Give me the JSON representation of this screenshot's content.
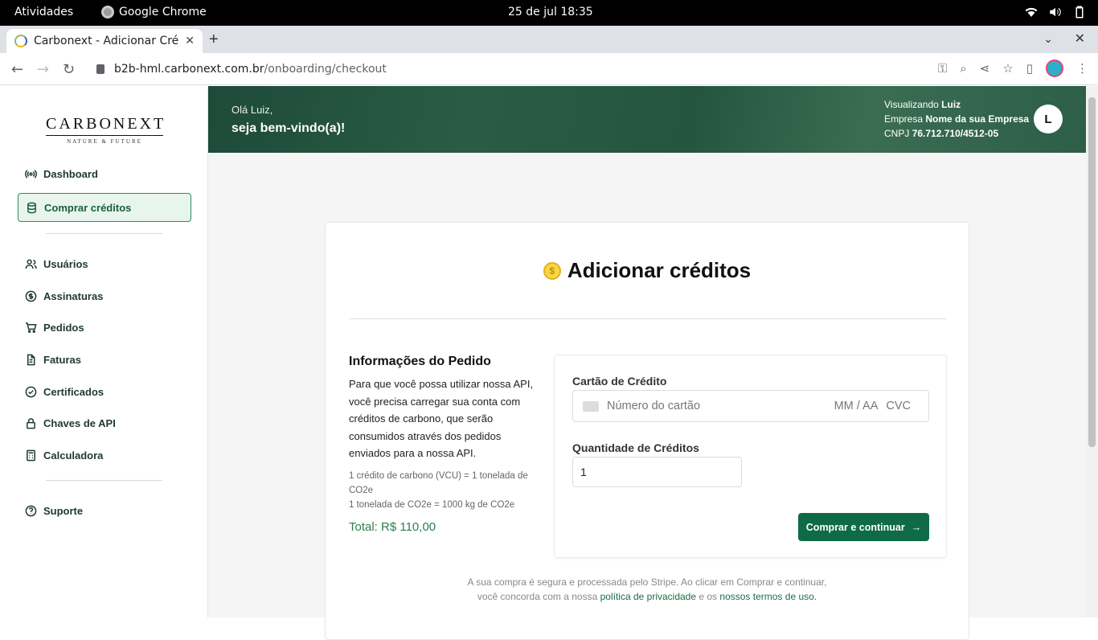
{
  "system": {
    "activities": "Atividades",
    "app_name": "Google Chrome",
    "clock": "25 de jul  18:35"
  },
  "browser": {
    "tab_title": "Carbonext - Adicionar Cré",
    "url_host": "b2b-hml.carbonext.com.br",
    "url_path": "/onboarding/checkout"
  },
  "sidebar": {
    "logo_word": "CARBONEXT",
    "logo_tag": "NATURE & FUTURE",
    "items": [
      {
        "label": "Dashboard",
        "icon": "broadcast-icon"
      },
      {
        "label": "Comprar créditos",
        "icon": "database-icon",
        "active": true
      },
      {
        "label": "Usuários",
        "icon": "users-icon"
      },
      {
        "label": "Assinaturas",
        "icon": "dollar-circle-icon"
      },
      {
        "label": "Pedidos",
        "icon": "cart-icon"
      },
      {
        "label": "Faturas",
        "icon": "file-icon"
      },
      {
        "label": "Certificados",
        "icon": "check-circle-icon"
      },
      {
        "label": "Chaves de API",
        "icon": "lock-icon"
      },
      {
        "label": "Calculadora",
        "icon": "calculator-icon"
      },
      {
        "label": "Suporte",
        "icon": "help-circle-icon"
      }
    ]
  },
  "header": {
    "hello": "Olá Luiz,",
    "welcome": "seja bem-vindo(a)!",
    "viewing_label": "Visualizando",
    "viewing_value": "Luiz",
    "company_label": "Empresa",
    "company_value": "Nome da sua Empresa",
    "cnpj_label": "CNPJ",
    "cnpj_value": "76.712.710/4512-05",
    "avatar_initial": "L"
  },
  "card": {
    "title": "Adicionar créditos",
    "coin_symbol": "$",
    "order": {
      "heading": "Informações do Pedido",
      "description": "Para que você possa utilizar nossa API, você precisa carregar sua conta com créditos de carbono, que serão consumidos através dos pedidos enviados para a nossa API.",
      "note_1": "1 crédito de carbono (VCU) = 1 tonelada de CO2e",
      "note_2": "1 tonelada de CO2e = 1000 kg de CO2e",
      "total": "Total: R$ 110,00"
    },
    "payment": {
      "card_label": "Cartão de Crédito",
      "card_placeholder": "Número do cartão",
      "exp_placeholder": "MM / AA",
      "cvc_placeholder": "CVC",
      "qty_label": "Quantidade de Créditos",
      "qty_value": "1",
      "buy_button": "Comprar e continuar"
    },
    "footer": {
      "line1": "A sua compra é segura e processada pelo Stripe. Ao clicar em Comprar e continuar,",
      "line2_prefix": "você concorda com a nossa",
      "privacy_link": "política de privacidade",
      "and": "e os",
      "terms_link": "nossos termos de uso."
    }
  }
}
